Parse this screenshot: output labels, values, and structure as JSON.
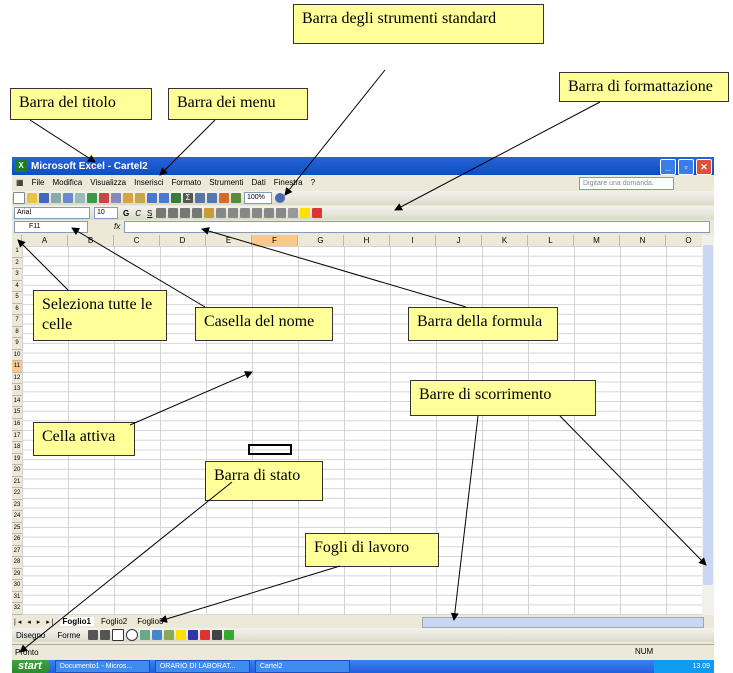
{
  "callouts": {
    "title_bar": "Barra del titolo",
    "menu_bar": "Barra dei menu",
    "standard_toolbar": "Barra  degli strumenti standard",
    "formatting_toolbar": "Barra di formattazione",
    "select_all": "Seleziona tutte le celle",
    "name_box": "Casella del nome",
    "formula_bar": "Barra della formula",
    "scrollbars": "Barre di scorrimento",
    "active_cell": "Cella attiva",
    "status_bar": "Barra di stato",
    "worksheets": "Fogli di lavoro"
  },
  "window": {
    "title": "Microsoft Excel - Cartel2"
  },
  "menu": {
    "items": [
      "File",
      "Modifica",
      "Visualizza",
      "Inserisci",
      "Formato",
      "Strumenti",
      "Dati",
      "Finestra",
      "?"
    ],
    "ask_placeholder": "Digitare una domanda."
  },
  "toolbar": {
    "zoom": "100%"
  },
  "format": {
    "font": "Arial",
    "size": "10",
    "bold": "G",
    "italic": "C",
    "underline": "S"
  },
  "formula": {
    "cell_ref": "F11",
    "fx": "fx"
  },
  "grid": {
    "columns": [
      "A",
      "B",
      "C",
      "D",
      "E",
      "F",
      "G",
      "H",
      "I",
      "J",
      "K",
      "L",
      "M",
      "N",
      "O"
    ],
    "selected_column": "F",
    "rows": [
      "1",
      "2",
      "3",
      "4",
      "5",
      "6",
      "7",
      "8",
      "9",
      "10",
      "11",
      "12",
      "13",
      "14",
      "15",
      "16",
      "17",
      "18",
      "19",
      "20",
      "21",
      "22",
      "23",
      "24",
      "25",
      "26",
      "27",
      "28",
      "29",
      "30",
      "31",
      "32"
    ],
    "selected_row": "11"
  },
  "sheets": {
    "tabs": [
      "Foglio1",
      "Foglio2",
      "Foglio3"
    ],
    "active": "Foglio1"
  },
  "drawing": {
    "draw_label": "Disegno",
    "shapes_label": "Forme"
  },
  "status": {
    "ready": "Pronto",
    "num": "NUM"
  },
  "taskbar": {
    "start": "start",
    "tasks": [
      "Documento1 - Micros...",
      "ORARIO DI LABORAT...",
      "Cartel2"
    ],
    "clock": "13.09"
  },
  "colors": {
    "callout_bg": "#ffff99",
    "title_bar": "#0a4fc4",
    "selected_header": "#f7c98a",
    "taskbar": "#245edb"
  }
}
